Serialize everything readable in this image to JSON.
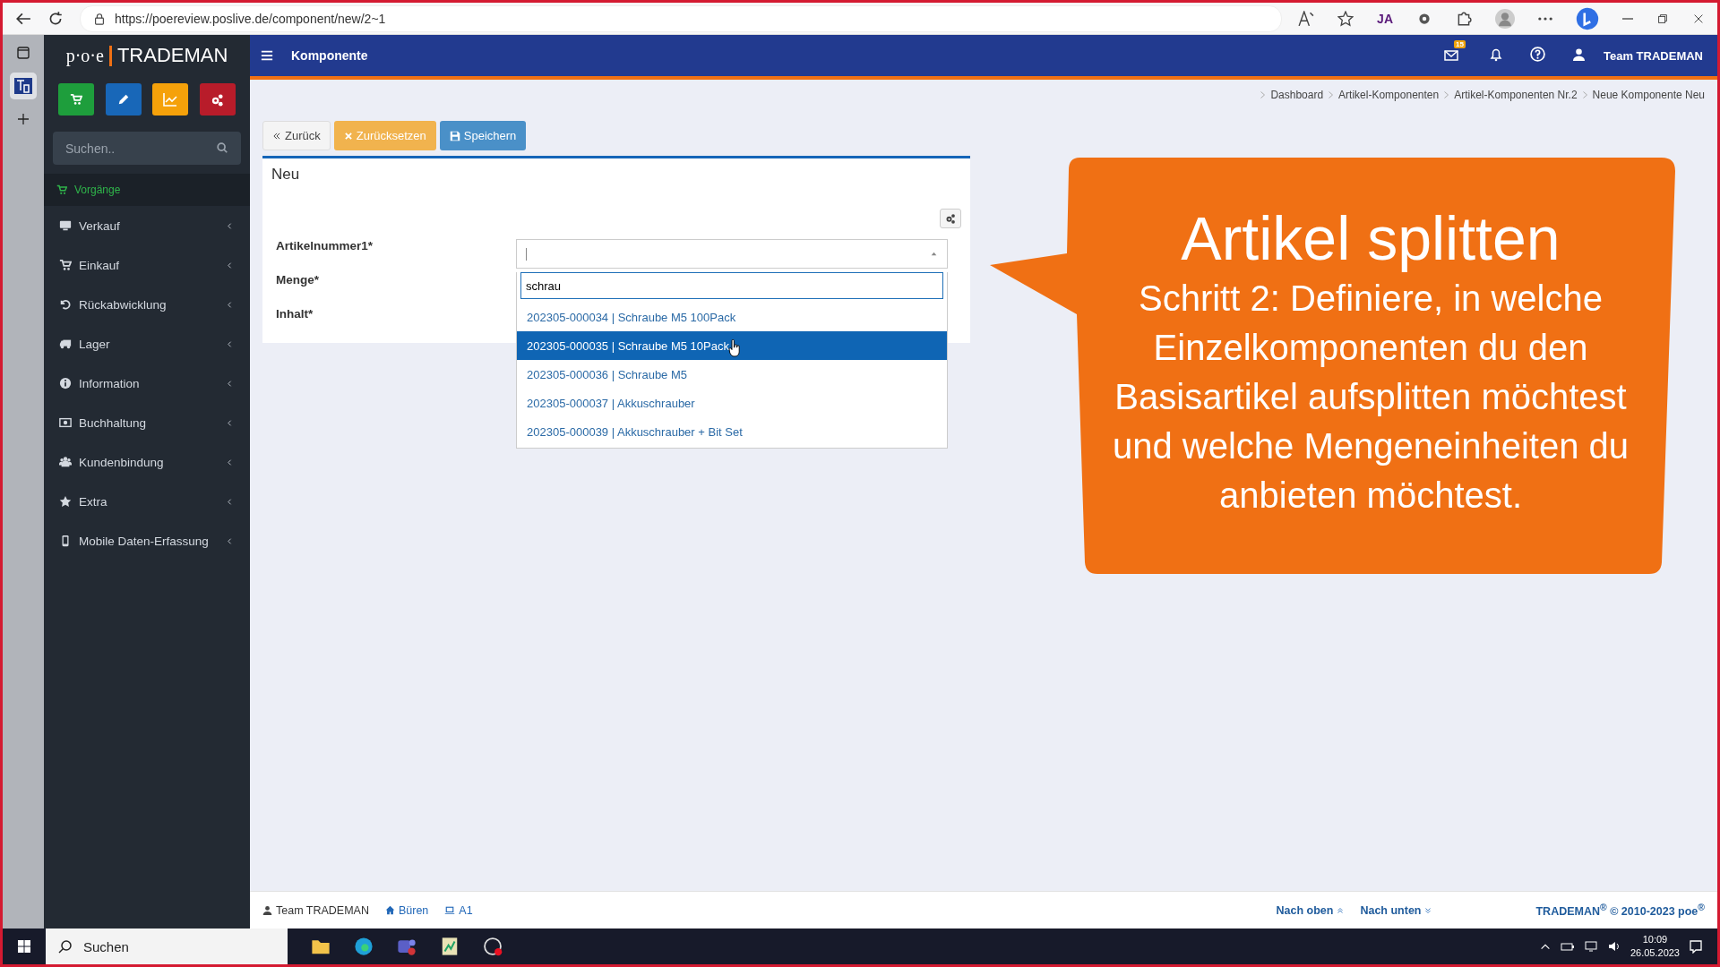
{
  "browser": {
    "url": "https://poereview.poslive.de/component/new/2~1",
    "extension_label": "JA"
  },
  "sidebar": {
    "logo_left": "p·o·e",
    "logo_right": "TRADEMAN",
    "search": {
      "placeholder": "Suchen.."
    },
    "section_label": "Vorgänge",
    "items": [
      {
        "label": "Verkauf"
      },
      {
        "label": "Einkauf"
      },
      {
        "label": "Rückabwicklung"
      },
      {
        "label": "Lager"
      },
      {
        "label": "Information"
      },
      {
        "label": "Buchhaltung"
      },
      {
        "label": "Kundenbindung"
      },
      {
        "label": "Extra"
      },
      {
        "label": "Mobile Daten-Erfassung"
      }
    ]
  },
  "header": {
    "title": "Komponente",
    "mail_count": "15",
    "user": "Team TRADEMAN"
  },
  "breadcrumb": [
    "Dashboard",
    "Artikel-Komponenten",
    "Artikel-Komponenten Nr.2",
    "Neue Komponente Neu"
  ],
  "toolbar": [
    {
      "label": "Zurück",
      "kind": "back"
    },
    {
      "label": "Zurücksetzen",
      "kind": "reset"
    },
    {
      "label": "Speichern",
      "kind": "save"
    }
  ],
  "form": {
    "title": "Neu",
    "fields": [
      "Artikelnummer1*",
      "Menge*",
      "Inhalt*"
    ],
    "dropdown": {
      "search_value": "schrau",
      "options": [
        {
          "label": "202305-000034 | Schraube M5 100Pack",
          "selected": false
        },
        {
          "label": "202305-000035 | Schraube M5 10Pack",
          "selected": true
        },
        {
          "label": "202305-000036 | Schraube M5",
          "selected": false
        },
        {
          "label": "202305-000037 | Akkuschrauber",
          "selected": false
        },
        {
          "label": "202305-000039 | Akkuschrauber + Bit Set",
          "selected": false
        }
      ]
    }
  },
  "callout": {
    "title": "Artikel splitten",
    "body": "Schritt 2: Definiere, in welche Einzelkomponenten du den Basisartikel aufsplitten möchtest und welche Mengeneinheiten du anbieten möchtest."
  },
  "footer": {
    "user": "Team TRADEMAN",
    "location": "Büren",
    "device": "A1",
    "up": "Nach oben",
    "down": "Nach unten",
    "copyright": "TRADEMAN$^{®}$ © 2010-2023 poe$^{®}$"
  },
  "taskbar": {
    "search": "Suchen",
    "time": "10:09",
    "date": "26.05.2023"
  }
}
